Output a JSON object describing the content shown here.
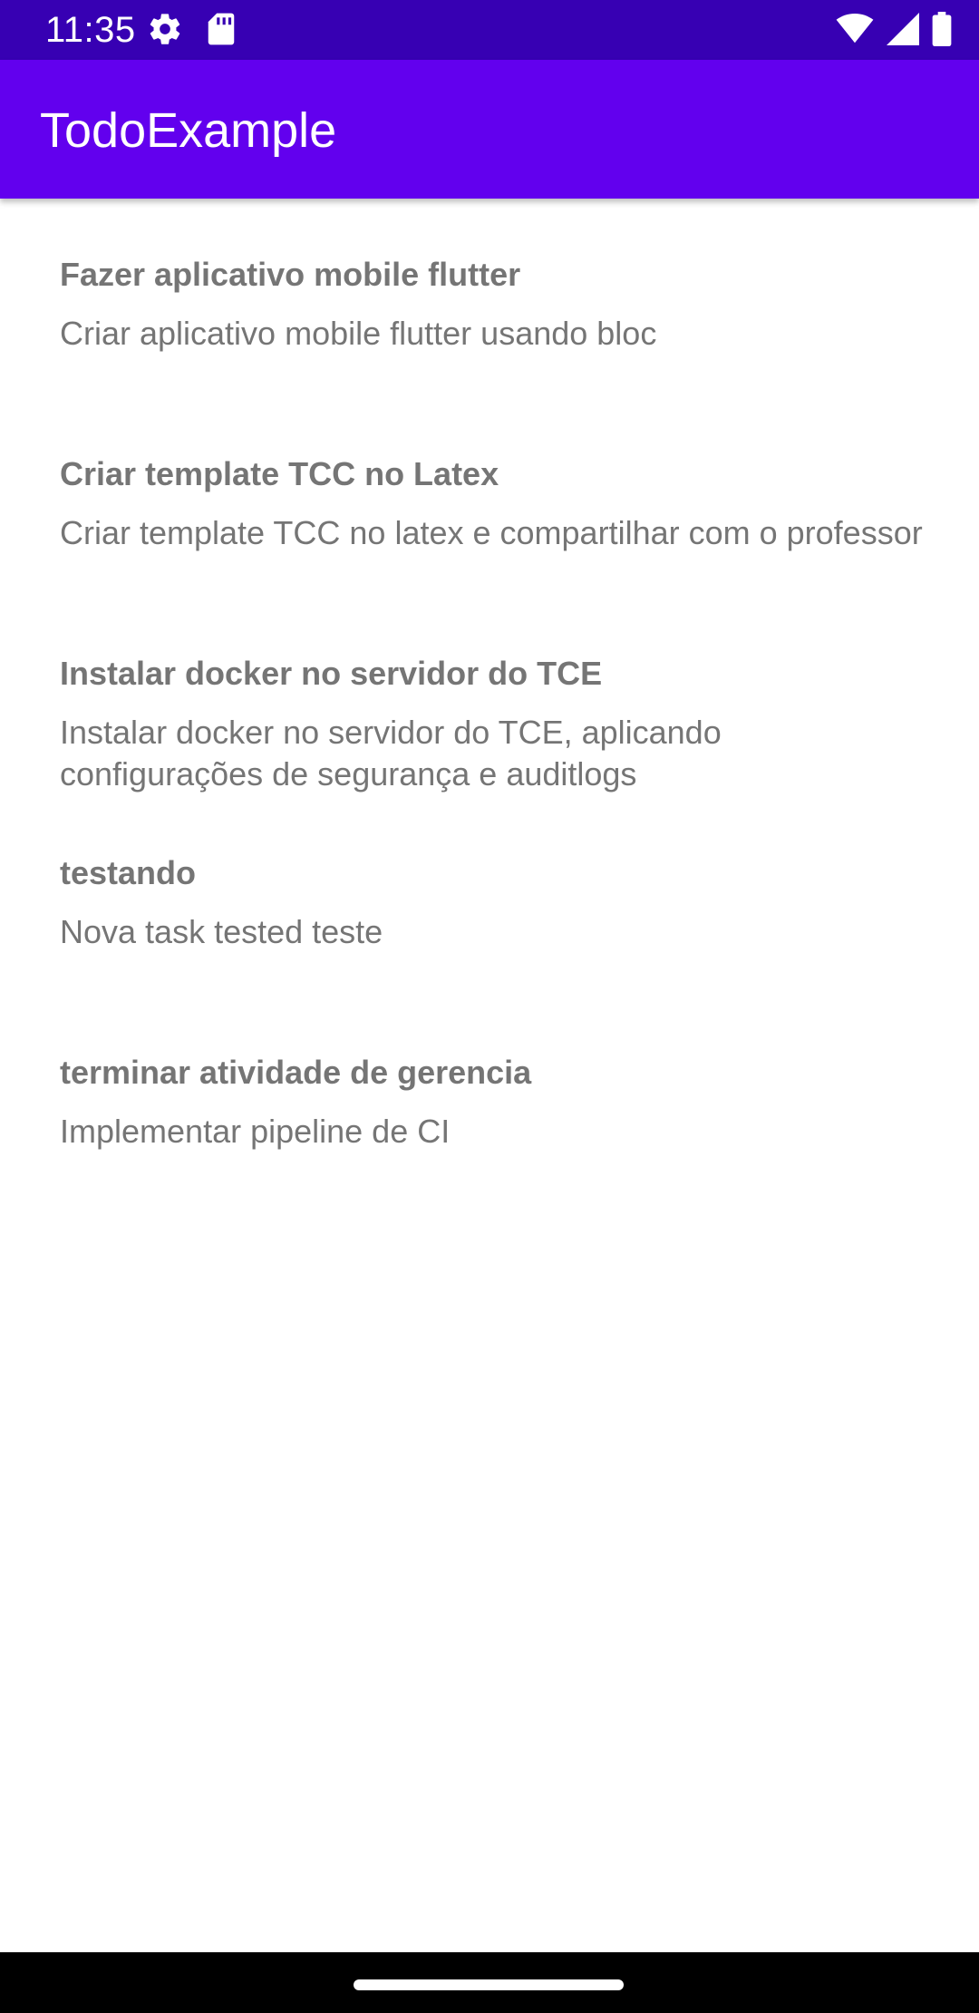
{
  "status_bar": {
    "time": "11:35",
    "icons": [
      "settings-icon",
      "sd-card-icon",
      "wifi-icon",
      "cell-signal-icon",
      "battery-icon"
    ],
    "background": "#3700b3"
  },
  "app_bar": {
    "title": "TodoExample",
    "background": "#6200ee"
  },
  "todos": [
    {
      "title": "Fazer aplicativo mobile flutter",
      "description": "Criar aplicativo mobile flutter usando bloc"
    },
    {
      "title": "Criar template TCC no Latex",
      "description": "Criar template TCC no latex e compartilhar com o professor"
    },
    {
      "title": "Instalar docker no servidor do TCE",
      "description": "Instalar docker no servidor do TCE, aplicando configurações de segurança e auditlogs"
    },
    {
      "title": "testando",
      "description": "Nova task tested teste"
    },
    {
      "title": "terminar atividade de gerencia",
      "description": "Implementar pipeline de CI"
    }
  ],
  "colors": {
    "text": "#757575",
    "nav_bar": "#000000"
  }
}
